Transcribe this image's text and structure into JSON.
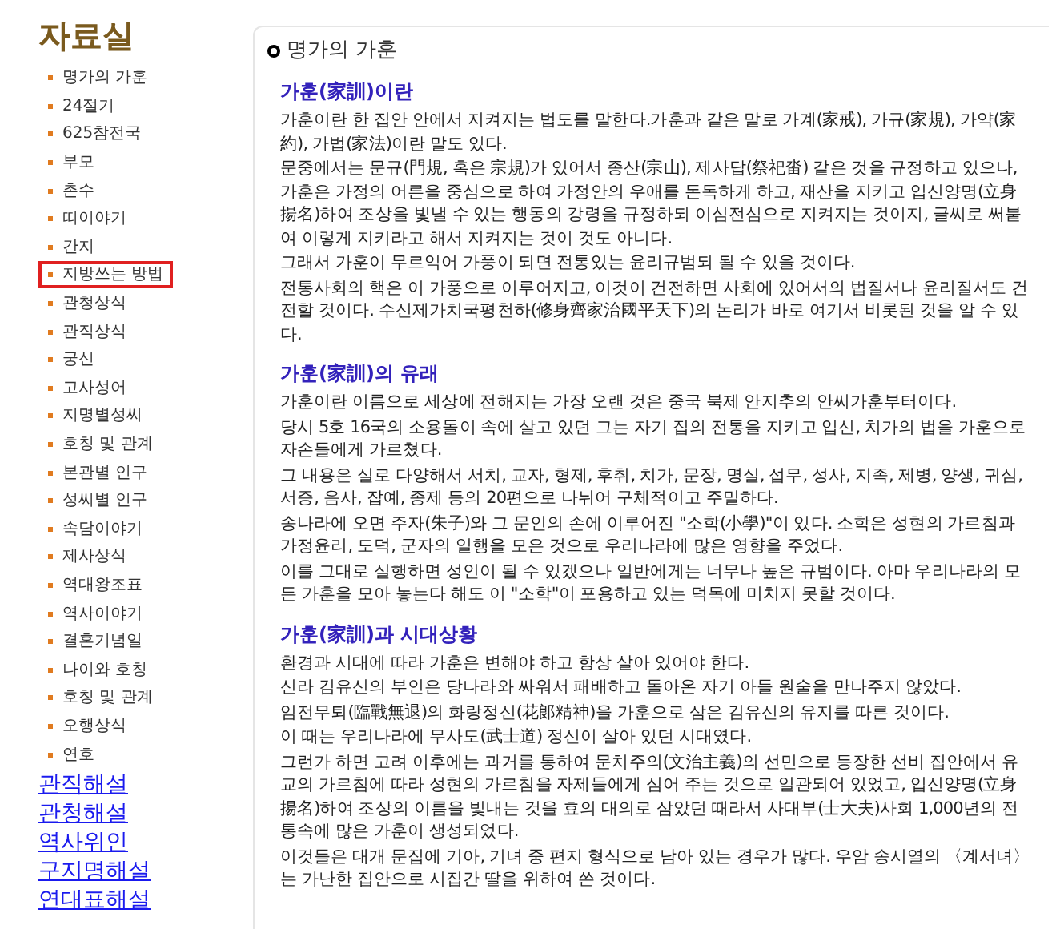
{
  "sidebar": {
    "title": "자료실",
    "items": [
      {
        "label": "명가의 가훈",
        "selected": false
      },
      {
        "label": "24절기",
        "selected": false
      },
      {
        "label": "625참전국",
        "selected": false
      },
      {
        "label": "부모",
        "selected": false
      },
      {
        "label": "촌수",
        "selected": false
      },
      {
        "label": "띠이야기",
        "selected": false
      },
      {
        "label": "간지",
        "selected": false
      },
      {
        "label": "지방쓰는 방법",
        "selected": true
      },
      {
        "label": "관청상식",
        "selected": false
      },
      {
        "label": "관직상식",
        "selected": false
      },
      {
        "label": "궁신",
        "selected": false
      },
      {
        "label": "고사성어",
        "selected": false
      },
      {
        "label": "지명별성씨",
        "selected": false
      },
      {
        "label": "호칭 및 관계",
        "selected": false
      },
      {
        "label": "본관별 인구",
        "selected": false
      },
      {
        "label": "성씨별 인구",
        "selected": false
      },
      {
        "label": "속담이야기",
        "selected": false
      },
      {
        "label": "제사상식",
        "selected": false
      },
      {
        "label": "역대왕조표",
        "selected": false
      },
      {
        "label": "역사이야기",
        "selected": false
      },
      {
        "label": "결혼기념일",
        "selected": false
      },
      {
        "label": "나이와 호칭",
        "selected": false
      },
      {
        "label": "호칭 및 관계",
        "selected": false
      },
      {
        "label": "오행상식",
        "selected": false
      },
      {
        "label": "연호",
        "selected": false
      }
    ],
    "links": [
      "관직해설",
      "관청해설",
      "역사위인",
      "구지명해설",
      "연대표해설"
    ]
  },
  "content": {
    "title": "명가의 가훈",
    "sections": [
      {
        "heading": "가훈(家訓)이란",
        "paragraphs": [
          "가훈이란 한 집안 안에서 지켜지는 법도를 말한다.가훈과 같은 말로 가계(家戒), 가규(家規), 가약(家約), 가법(家法)이란 말도 있다.",
          "문중에서는 문규(門規, 혹은 宗規)가 있어서 종산(宗山), 제사답(祭祀畓) 같은 것을 규정하고 있으나, 가훈은 가정의 어른을 중심으로 하여 가정안의 우애를 돈독하게 하고, 재산을 지키고 입신양명(立身揚名)하여 조상을 빛낼 수 있는 행동의 강령을 규정하되 이심전심으로 지켜지는 것이지, 글씨로 써붙여 이렇게 지키라고 해서 지켜지는 것이 것도 아니다.",
          "그래서 가훈이 무르익어 가풍이 되면 전통있는 윤리규범되 될 수 있을 것이다.",
          "전통사회의 핵은 이 가풍으로 이루어지고, 이것이 건전하면 사회에 있어서의 법질서나 윤리질서도 건전할 것이다. 수신제가치국평천하(修身齊家治國平天下)의 논리가 바로 여기서 비롯된 것을 알 수 있다."
        ]
      },
      {
        "heading": "가훈(家訓)의 유래",
        "paragraphs": [
          "가훈이란 이름으로 세상에 전해지는 가장 오랜 것은 중국 북제 안지추의 안씨가훈부터이다.",
          "당시 5호 16국의 소용돌이 속에 살고 있던 그는 자기 집의 전통을 지키고 입신, 치가의 법을 가훈으로 자손들에게 가르쳤다.",
          "그 내용은 실로 다양해서 서치, 교자, 형제, 후취, 치가, 문장, 명실, 섭무, 성사, 지족, 제병, 양생, 귀심, 서증, 음사, 잡예, 종제 등의 20편으로 나뉘어 구체적이고 주밀하다.",
          "송나라에 오면 주자(朱子)와 그 문인의 손에 이루어진 \"소학(小學)\"이 있다. 소학은 성현의 가르침과 가정윤리, 도덕, 군자의 일행을 모은 것으로 우리나라에 많은 영향을 주었다.",
          "이를 그대로 실행하면 성인이 될 수 있겠으나 일반에게는 너무나 높은 규범이다. 아마 우리나라의 모든 가훈을 모아 놓는다 해도 이 \"소학\"이 포용하고 있는 덕목에 미치지 못할 것이다."
        ]
      },
      {
        "heading": "가훈(家訓)과 시대상황",
        "paragraphs": [
          "환경과 시대에 따라 가훈은 변해야 하고 항상 살아 있어야 한다.",
          "신라 김유신의 부인은 당나라와 싸워서 패배하고 돌아온 자기 아들 원술을 만나주지 않았다.",
          "임전무퇴(臨戰無退)의 화랑정신(花郞精神)을 가훈으로 삼은 김유신의 유지를 따른 것이다.",
          "이 때는 우리나라에 무사도(武士道) 정신이 살아 있던 시대였다.",
          "그런가 하면 고려 이후에는 과거를 통하여 문치주의(文治主義)의 선민으로 등장한 선비 집안에서 유교의 가르침에 따라 성현의 가르침을 자제들에게 심어 주는 것으로 일관되어 있었고, 입신양명(立身揚名)하여 조상의 이름을 빛내는 것을 효의 대의로 삼았던 때라서 사대부(士大夫)사회 1,000년의 전통속에 많은 가훈이 생성되었다.",
          "이것들은 대개 문집에 기아, 기녀 중 편지 형식으로 남아 있는 경우가 많다. 우암 송시열의 〈계서녀〉는 가난한 집안으로 시집간 딸을 위하여 쓴 것이다."
        ]
      }
    ]
  }
}
